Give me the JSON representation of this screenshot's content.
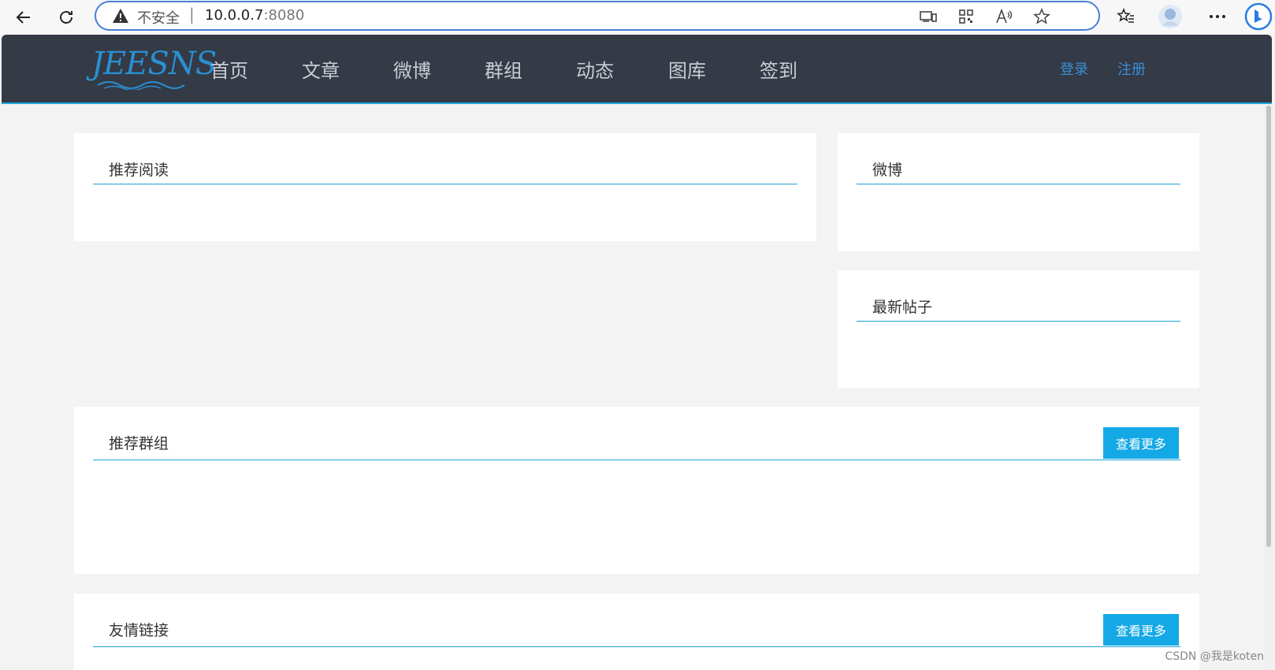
{
  "browser": {
    "security_label": "不安全",
    "url_host": "10.0.0.7",
    "url_port": ":8080"
  },
  "site": {
    "logo_text": "JEESNS",
    "nav": [
      "首页",
      "文章",
      "微博",
      "群组",
      "动态",
      "图库",
      "签到"
    ],
    "login": "登录",
    "register": "注册"
  },
  "panels": {
    "recommended_reading": {
      "title": "推荐阅读"
    },
    "weibo": {
      "title": "微博"
    },
    "latest_posts": {
      "title": "最新帖子"
    },
    "recommended_groups": {
      "title": "推荐群组",
      "more": "查看更多"
    },
    "friend_links": {
      "title": "友情链接",
      "more": "查看更多"
    }
  },
  "watermark": "CSDN @我是koten",
  "colors": {
    "accent": "#1fa6e0",
    "header_bg": "#343a46",
    "button": "#14a9e6"
  }
}
